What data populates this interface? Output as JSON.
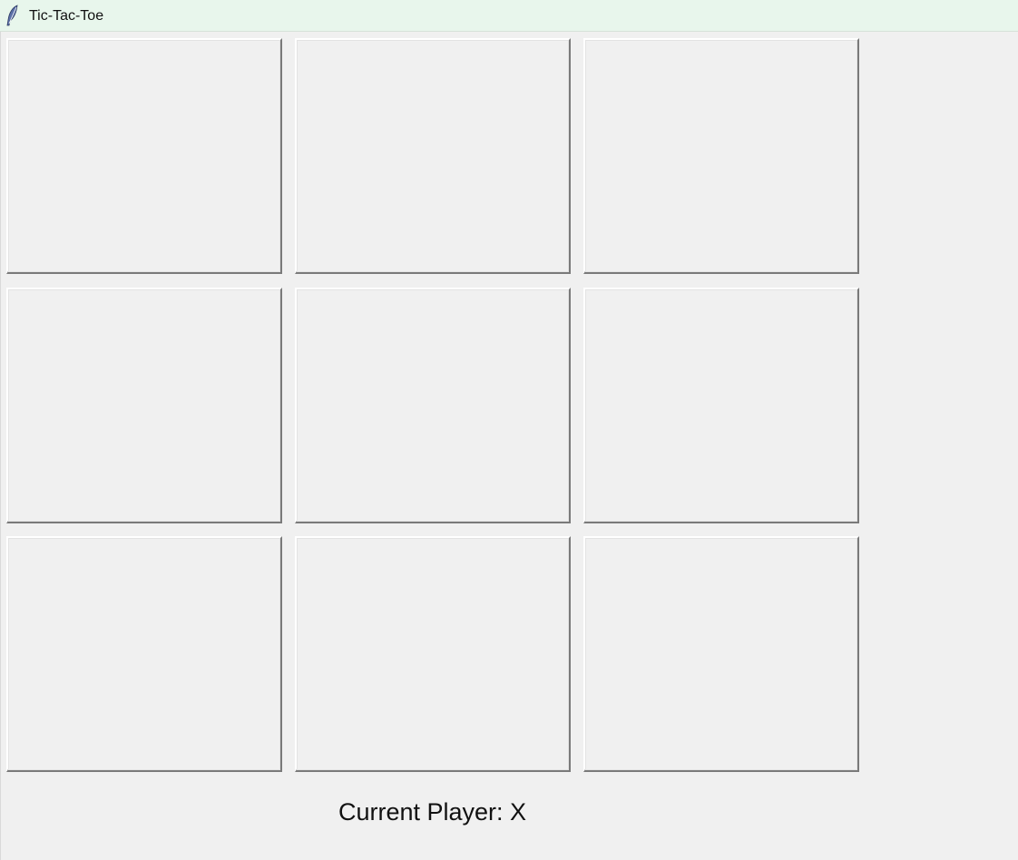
{
  "window": {
    "title": "Tic-Tac-Toe",
    "icon": "feather-icon"
  },
  "board": {
    "cells": [
      "",
      "",
      "",
      "",
      "",
      "",
      "",
      "",
      ""
    ]
  },
  "status": {
    "text": "Current Player: X"
  }
}
